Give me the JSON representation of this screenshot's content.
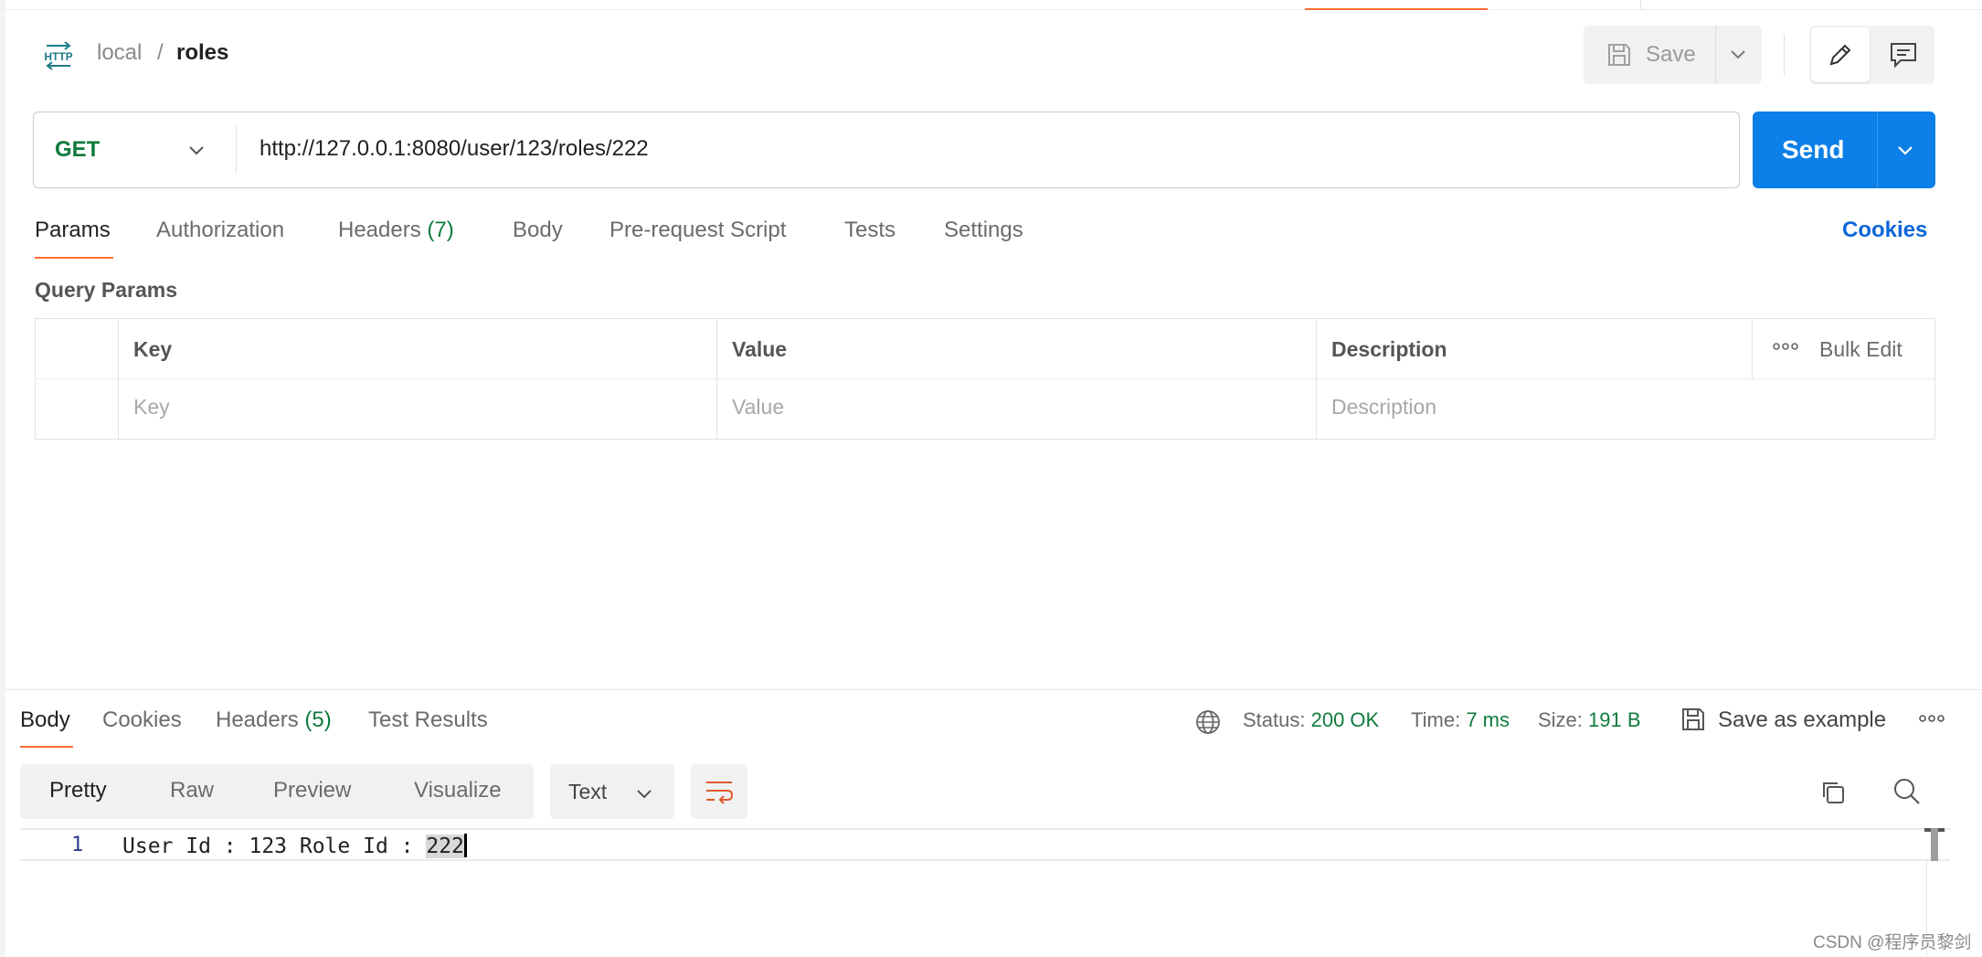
{
  "header": {
    "http_badge": "HTTP",
    "breadcrumb": {
      "collection": "local",
      "separator": "/",
      "request": "roles"
    },
    "save_label": "Save"
  },
  "request": {
    "method": "GET",
    "url": "http://127.0.0.1:8080/user/123/roles/222",
    "send_label": "Send"
  },
  "tabs": {
    "params": "Params",
    "authorization": "Authorization",
    "headers": "Headers",
    "headers_count": "(7)",
    "body": "Body",
    "pre_request": "Pre-request Script",
    "tests": "Tests",
    "settings": "Settings",
    "cookies": "Cookies"
  },
  "query_params": {
    "title": "Query Params",
    "columns": [
      "Key",
      "Value",
      "Description"
    ],
    "placeholders": [
      "Key",
      "Value",
      "Description"
    ],
    "bulk_edit": "Bulk Edit"
  },
  "response": {
    "tabs": {
      "body": "Body",
      "cookies": "Cookies",
      "headers": "Headers",
      "headers_count": "(5)",
      "test_results": "Test Results"
    },
    "status_label": "Status:",
    "status_value": "200 OK",
    "time_label": "Time:",
    "time_value": "7 ms",
    "size_label": "Size:",
    "size_value": "191 B",
    "save_example": "Save as example",
    "formats": [
      "Pretty",
      "Raw",
      "Preview",
      "Visualize"
    ],
    "language": "Text",
    "line_number": "1",
    "body_text": "User Id : 123 Role Id : ",
    "body_selected": "222"
  },
  "watermark": "CSDN @程序员黎剑",
  "colors": {
    "accent_orange": "#ff6c37",
    "send_blue": "#0c7fe8",
    "method_green": "#0f7b3c",
    "link_blue": "#0c66d8"
  }
}
